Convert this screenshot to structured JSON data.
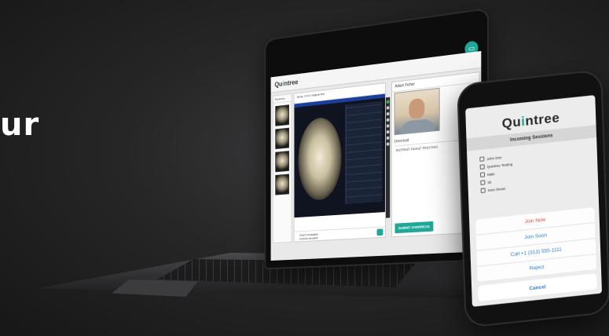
{
  "hero": {
    "text": "ur"
  },
  "laptop": {
    "app_logo": {
      "prefix": "Qu",
      "accent": "i",
      "suffix": "ntree"
    },
    "sessions_label": "Sessions",
    "viewer_title": "Body, 14:01 original text",
    "video_caller": "Adam Fisher",
    "overread_label": "Overread",
    "overread_text": "normal nasal mucosa",
    "complaint_label": "Chief Complaint",
    "complaint_value": "chronic sinusitis",
    "submit_label": "SUBMIT OVERREAD"
  },
  "phone": {
    "logo": {
      "prefix": "Qu",
      "accent": "i",
      "suffix": "ntree"
    },
    "title": "Incoming Sessions",
    "list": [
      {
        "label": "John Doe",
        "icon": "stethoscope-icon"
      },
      {
        "label": "Quintree Testing",
        "icon": "building-icon"
      },
      {
        "label": "Male",
        "icon": "gender-icon"
      },
      {
        "label": "35",
        "icon": "calendar-icon"
      },
      {
        "label": "Sore throat",
        "icon": "clipboard-icon"
      }
    ],
    "actions": {
      "join_now": "Join Now",
      "join_soon": "Join Soon",
      "call": "Call +1 (313) 555-1111",
      "reject": "Reject",
      "cancel": "Cancel"
    }
  },
  "colors": {
    "accent": "#1fa79a",
    "danger": "#e04b3a",
    "link": "#2d7fd6"
  }
}
